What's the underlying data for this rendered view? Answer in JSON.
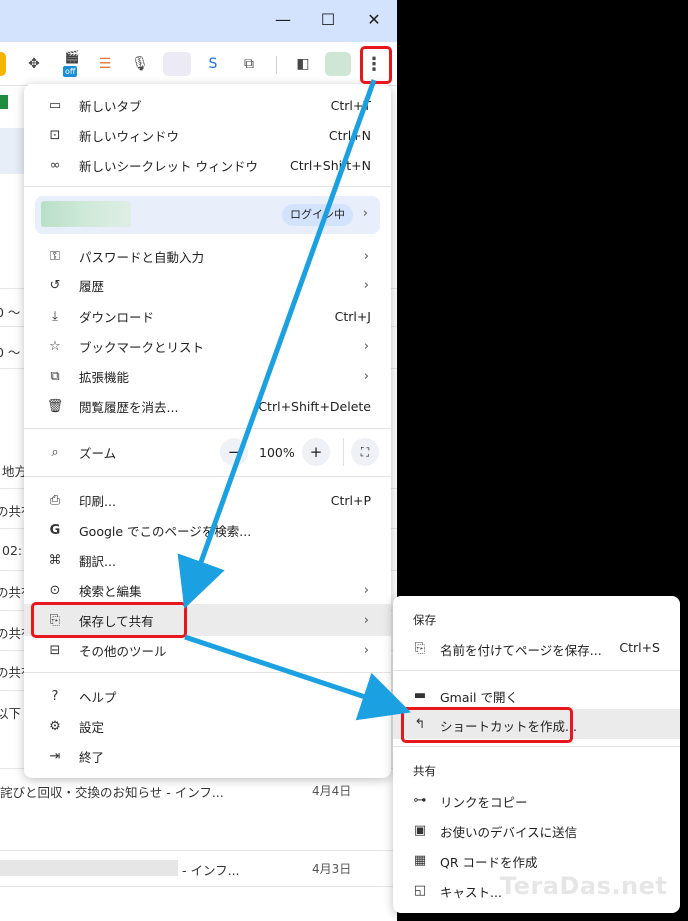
{
  "window": {
    "minimize": "—",
    "maximize": "☐",
    "close": "✕"
  },
  "toolbar": {
    "extension_badge": "off"
  },
  "background": {
    "rows": [
      {
        "text": "0 〜"
      },
      {
        "text": "0 〜"
      },
      {
        "text": "地方"
      },
      {
        "text": "の共有"
      },
      {
        "text": "02:"
      },
      {
        "text": "の共有"
      },
      {
        "text": "の共有"
      },
      {
        "text": "の共有"
      },
      {
        "text": "以下"
      },
      {
        "text": "詫びと回収・交換のお知らせ - インフ..."
      },
      {
        "text": "- インフ..."
      }
    ],
    "dates": [
      "4月4日",
      "4月3日"
    ]
  },
  "menu": {
    "items_top": [
      {
        "icon": "new-tab-icon",
        "label": "新しいタブ",
        "shortcut": "Ctrl+T"
      },
      {
        "icon": "new-window-icon",
        "label": "新しいウィンドウ",
        "shortcut": "Ctrl+N"
      },
      {
        "icon": "incognito-icon",
        "label": "新しいシークレット ウィンドウ",
        "shortcut": "Ctrl+Shift+N"
      }
    ],
    "profile_badge": "ログイン中",
    "items_mid": [
      {
        "icon": "key-icon",
        "label": "パスワードと自動入力"
      },
      {
        "icon": "history-icon",
        "label": "履歴"
      },
      {
        "icon": "download-icon",
        "label": "ダウンロード",
        "shortcut": "Ctrl+J"
      },
      {
        "icon": "star-icon",
        "label": "ブックマークとリスト"
      },
      {
        "icon": "puzzle-icon",
        "label": "拡張機能"
      },
      {
        "icon": "trash-icon",
        "label": "閲覧履歴を消去...",
        "shortcut": "Ctrl+Shift+Delete"
      }
    ],
    "zoom": {
      "label": "ズーム",
      "minus": "−",
      "value": "100%",
      "plus": "+"
    },
    "items_tools": [
      {
        "icon": "print-icon",
        "label": "印刷...",
        "shortcut": "Ctrl+P"
      },
      {
        "icon": "google-icon",
        "label": "Google でこのページを検索..."
      },
      {
        "icon": "translate-icon",
        "label": "翻訳..."
      },
      {
        "icon": "search-edit-icon",
        "label": "検索と編集"
      },
      {
        "icon": "save-share-icon",
        "label": "保存して共有"
      },
      {
        "icon": "toolbox-icon",
        "label": "その他のツール"
      }
    ],
    "items_bottom": [
      {
        "icon": "help-icon",
        "label": "ヘルプ"
      },
      {
        "icon": "gear-icon",
        "label": "設定"
      },
      {
        "icon": "exit-icon",
        "label": "終了"
      }
    ]
  },
  "submenu": {
    "save_header": "保存",
    "save_items": [
      {
        "icon": "save-page-icon",
        "label": "名前を付けてページを保存...",
        "shortcut": "Ctrl+S"
      },
      {
        "icon": "gmail-icon",
        "label": "Gmail で開く"
      },
      {
        "icon": "shortcut-icon",
        "label": "ショートカットを作成..."
      }
    ],
    "share_header": "共有",
    "share_items": [
      {
        "icon": "link-icon",
        "label": "リンクをコピー"
      },
      {
        "icon": "devices-icon",
        "label": "お使いのデバイスに送信"
      },
      {
        "icon": "qr-icon",
        "label": "QR コードを作成"
      },
      {
        "icon": "cast-icon",
        "label": "キャスト..."
      }
    ]
  },
  "watermark": "TeraDas.net",
  "colors": {
    "highlight": "#e8171e",
    "arrow": "#1ba1e2",
    "titlebar": "#d3e3fd"
  }
}
